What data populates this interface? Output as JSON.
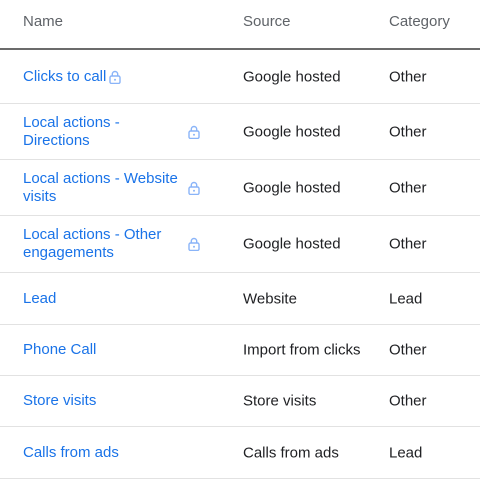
{
  "headers": {
    "name": "Name",
    "source": "Source",
    "category": "Category"
  },
  "rows": [
    {
      "name": "Clicks to call",
      "source": "Google hosted",
      "category": "Other",
      "icon": "lock-icon"
    },
    {
      "name": "Local actions - Directions",
      "source": "Google hosted",
      "category": "Other",
      "icon": "lock-icon"
    },
    {
      "name": "Local actions - Website visits",
      "source": "Google hosted",
      "category": "Other",
      "icon": "lock-icon"
    },
    {
      "name": "Local actions - Other engagements",
      "source": "Google hosted",
      "category": "Other",
      "icon": "lock-icon"
    },
    {
      "name": "Lead",
      "source": "Website",
      "category": "Lead"
    },
    {
      "name": "Phone Call",
      "source": "Import from clicks",
      "category": "Other"
    },
    {
      "name": "Store visits",
      "source": "Store visits",
      "category": "Other"
    },
    {
      "name": "Calls from ads",
      "source": "Calls from ads",
      "category": "Lead"
    }
  ],
  "colors": {
    "link": "#1a73e8",
    "text": "#202124",
    "header_text": "#5f6368",
    "lock": "#8ab4f8"
  }
}
